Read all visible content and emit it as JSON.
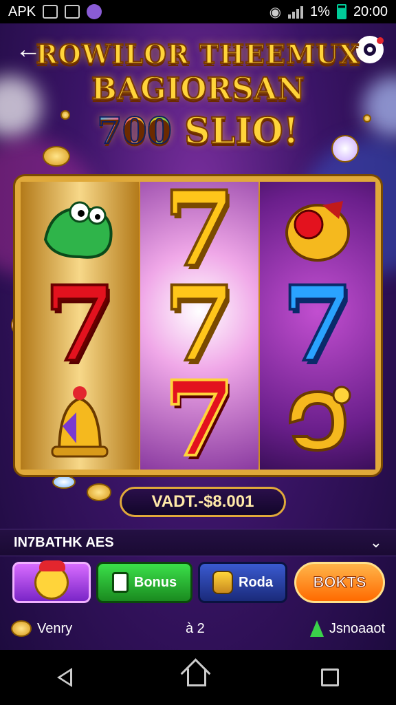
{
  "status_bar": {
    "app_label": "APK",
    "battery_text": "1%",
    "time": "20:00"
  },
  "header": {
    "title_line1": "ROWILOR THEEMUX",
    "title_line2": "BAGIORSAN",
    "title_number": "700",
    "title_suffix": "SLIO!",
    "back_icon": "back-arrow-icon",
    "profile_icon": "profile-icon"
  },
  "reels": [
    {
      "symbols": [
        "green-frog-icon",
        "7",
        "golden-bell-icon"
      ],
      "seven_color": "#e3121e"
    },
    {
      "symbols": [
        "7",
        "7",
        "7"
      ],
      "seven_colors": [
        "#ffc61a",
        "#ffc61a",
        "#e3121e"
      ]
    },
    {
      "symbols": [
        "cherry-bell-icon",
        "7",
        "golden-horseshoe-icon"
      ],
      "seven_color": "#2aa3ff"
    }
  ],
  "balance": {
    "text": "VADT.-$8.001"
  },
  "section": {
    "label": "IN7BATHK AES",
    "arrow_icon": "chevron-down-icon"
  },
  "buttons": {
    "character_button_icon": "character-face-icon",
    "bonus_label": "Bonus",
    "roda_label": "Roda",
    "bokts_label": "BOKTS"
  },
  "footer": {
    "left_label": "Venry",
    "center_label": "à 2",
    "right_label": "Jsnoaaot"
  },
  "colors": {
    "background": "#3a1466",
    "gold_frame": "#e0a93a",
    "bonus_green": "#3be04a",
    "roda_blue": "#3a5ad0",
    "bokts_orange": "#ff6a00"
  }
}
